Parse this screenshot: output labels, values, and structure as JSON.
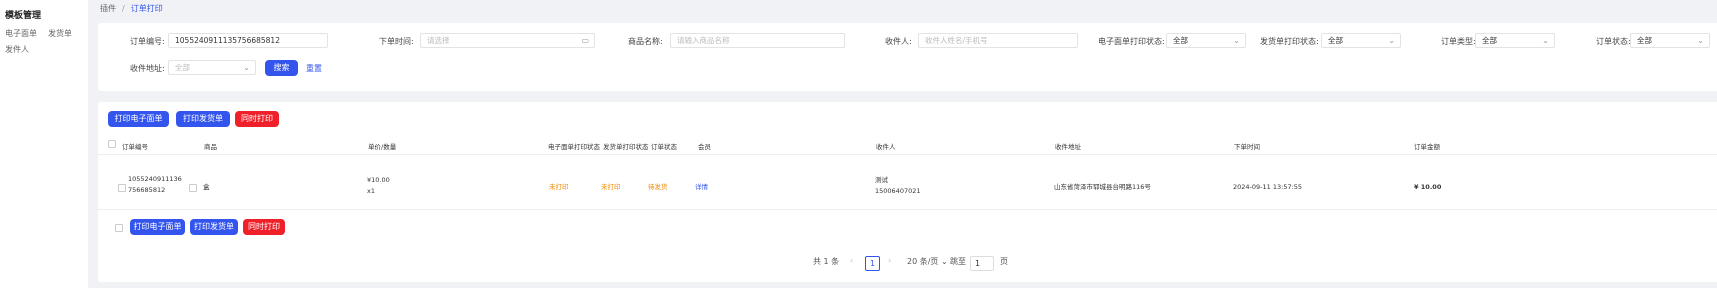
{
  "sidebar": {
    "title": "模板管理",
    "links": [
      "电子面单",
      "发货单",
      "发件人"
    ]
  },
  "breadcrumb": {
    "parent": "插件",
    "sep": "/",
    "current": "订单打印"
  },
  "filters": {
    "order_no": {
      "label": "订单编号:",
      "value": "1055240911135756685812"
    },
    "order_time": {
      "label": "下单时间:",
      "placeholder": "请选择"
    },
    "product_name": {
      "label": "商品名称:",
      "placeholder": "请输入商品名称"
    },
    "receiver": {
      "label": "收件人:",
      "placeholder": "收件人姓名/手机号"
    },
    "waybill_status": {
      "label": "电子面单打印状态:",
      "value": "全部"
    },
    "delivery_status": {
      "label": "发货单打印状态:",
      "value": "全部"
    },
    "order_type": {
      "label": "订单类型:",
      "value": "全部"
    },
    "order_state": {
      "label": "订单状态:",
      "value": "全部"
    },
    "address": {
      "label": "收件地址:",
      "placeholder": "全部"
    },
    "search_label": "搜索",
    "reset_label": "重置"
  },
  "actions": {
    "print_waybill": "打印电子面单",
    "print_delivery": "打印发货单",
    "print_both": "同时打印"
  },
  "table": {
    "headers": [
      "订单编号",
      "商品",
      "单价/数量",
      "电子面单打印状态",
      "发货单打印状态",
      "订单状态",
      "会员",
      "收件人",
      "收件地址",
      "下单时间",
      "订单金额"
    ],
    "rows": [
      {
        "order_no_1": "1055240911136",
        "order_no_2": "756685812",
        "product": "盒",
        "price": "¥10.00",
        "qty": "x1",
        "waybill_status": "未打印",
        "delivery_status": "未打印",
        "order_status": "待发货",
        "member": "详情",
        "receiver_name": "测试",
        "receiver_phone": "15006407021",
        "address": "山东省菏泽市郓城县台明路116号",
        "time": "2024-09-11 13:57:55",
        "amount": "¥ 10.00"
      }
    ]
  },
  "pagination": {
    "total": "共 1 条",
    "prev": "‹",
    "current": "1",
    "next": "›",
    "page_size": "20 条/页",
    "goto_label": "跳至",
    "goto_value": "1",
    "page_unit": "页"
  },
  "colors": {
    "accent": "#3355ee",
    "danger": "#f0202a",
    "warning": "#f08a00"
  }
}
